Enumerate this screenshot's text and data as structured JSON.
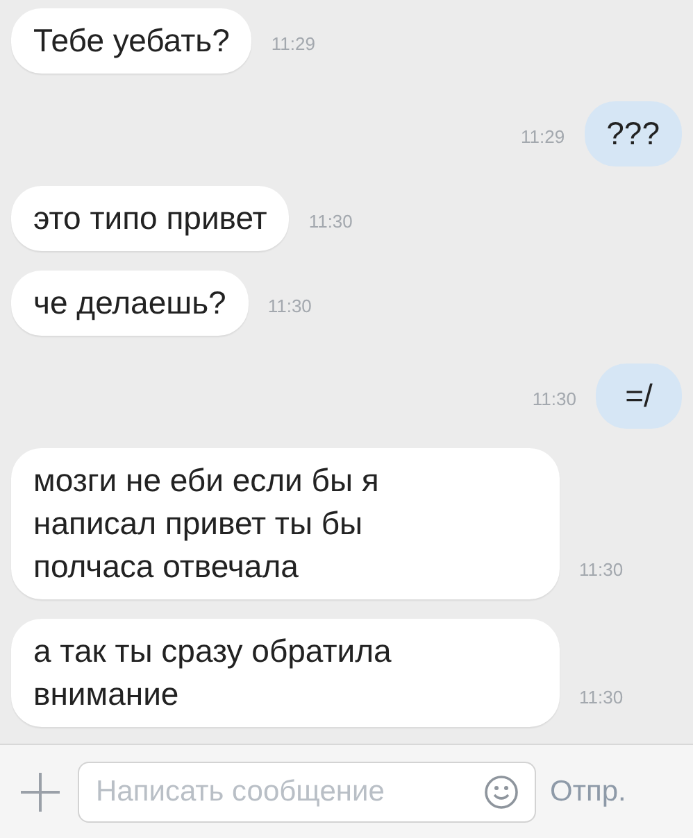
{
  "messages": [
    {
      "kind": "incoming",
      "text": "Тебе уебать?",
      "time": "11:29"
    },
    {
      "kind": "outgoing",
      "text": "???",
      "time": "11:29"
    },
    {
      "kind": "incoming",
      "text": "это типо привет",
      "time": "11:30"
    },
    {
      "kind": "incoming",
      "text": "че делаешь?",
      "time": "11:30"
    },
    {
      "kind": "outgoing",
      "text": "=/",
      "time": "11:30"
    },
    {
      "kind": "incoming",
      "text": "мозги не еби если бы я написал привет ты бы полчаса отвечала",
      "time": "11:30"
    },
    {
      "kind": "incoming",
      "text": "а так ты сразу обратила внимание",
      "time": "11:30"
    }
  ],
  "composer": {
    "placeholder": "Написать сообщение",
    "send": "Отпр."
  }
}
